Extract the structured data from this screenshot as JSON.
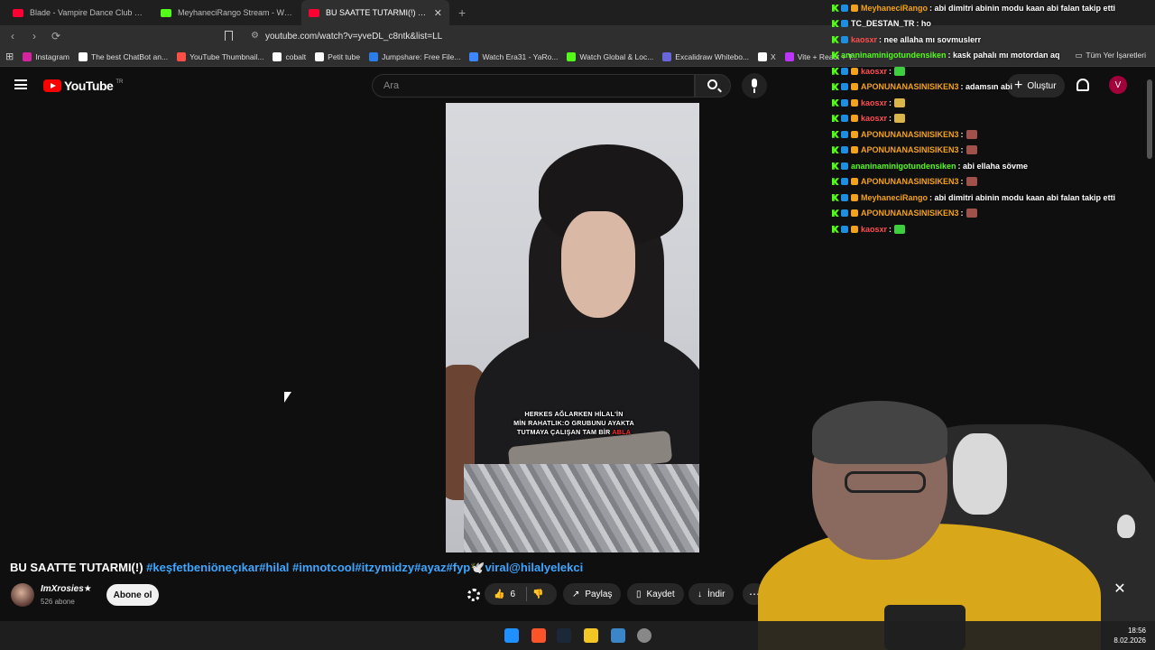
{
  "browser": {
    "tabs": [
      {
        "label": "Blade - Vampire Dance Club Theme",
        "color": "#ff0033",
        "active": false
      },
      {
        "label": "MeyhaneciRango Stream - Watch Live",
        "color": "#53fc18",
        "active": false
      },
      {
        "label": "BU SAATTE TUTARMI(!) #keşfetb",
        "color": "#ff0033",
        "active": true
      }
    ],
    "tab_close": "✕",
    "new_tab": "+",
    "url": "youtube.com/watch?v=yveDL_c8ntk&list=LL",
    "bookmarks": [
      {
        "label": "Instagram",
        "color": "#d6249f"
      },
      {
        "label": "The best ChatBot an...",
        "color": "#ffffff"
      },
      {
        "label": "YouTube Thumbnail...",
        "color": "#ff4e45"
      },
      {
        "label": "cobalt",
        "color": "#ffffff"
      },
      {
        "label": "Petit tube",
        "color": "#ffffff"
      },
      {
        "label": "Jumpshare: Free File...",
        "color": "#2b7de9"
      },
      {
        "label": "Watch Era31 - YaRo...",
        "color": "#3d86ff"
      },
      {
        "label": "Watch Global & Loc...",
        "color": "#53fc18"
      },
      {
        "label": "Excalidraw Whitebo...",
        "color": "#6965db"
      },
      {
        "label": "X",
        "color": "#ffffff"
      },
      {
        "label": "Vite + React + T...",
        "color": "#bd34fe"
      }
    ],
    "bookmarks_right": "Tüm Yer İşaretleri"
  },
  "youtube": {
    "logo_word": "YouTube",
    "country": "TR",
    "search_placeholder": "Ara",
    "create_label": "Oluştur",
    "avatar_letter": "V"
  },
  "video": {
    "caption_lines": [
      "HERKES AĞLARKEN HİLAL'İN",
      "MİN RAHATLIK:O GRUBUNU AYAKTA",
      "TUTMAYA ÇALIŞAN TAM BİR"
    ],
    "caption_highlight": "ABLA",
    "title_main": "BU SAATTE TUTARMI(!) ",
    "title_tags": "#keşfetbeniöneçıkar#hilal #imnotcool#itzymidzy#ayaz#fyp🕊️viral@hilalyelekci",
    "channel_name": "ImXrosies★",
    "subscribers": "526 abone",
    "subscribe_label": "Abone ol",
    "like_count": "6",
    "share_label": "Paylaş",
    "save_label": "Kaydet",
    "download_label": "İndir",
    "more_label": "⋯"
  },
  "chat": [
    {
      "user": "MeyhaneciRango",
      "color": "#f3a21a",
      "text": ": abi dimitri abinin modu kaan abi falan takip etti",
      "badges": 2
    },
    {
      "user": "TC_DESTAN_TR",
      "color": "#ffffff",
      "text": ": ho",
      "badges": 1
    },
    {
      "user": "kaosxr",
      "color": "#ff4d4d",
      "text": ": nee allaha mı sovmuslerr",
      "badges": 1
    },
    {
      "user": "ananinaminigotundensiken",
      "color": "#53fc18",
      "text": ": kask pahalı mı motordan aq",
      "badges": 0
    },
    {
      "user": "kaosxr",
      "color": "#ff4d4d",
      "text": ":",
      "badges": 2,
      "emote": "#3ecf3e"
    },
    {
      "user": "APONUNANASINISIKEN3",
      "color": "#f3a21a",
      "text": ": adamsın abi",
      "badges": 2
    },
    {
      "user": "kaosxr",
      "color": "#ff4d4d",
      "text": ":",
      "badges": 2,
      "emote": "#d9b54a"
    },
    {
      "user": "kaosxr",
      "color": "#ff4d4d",
      "text": ":",
      "badges": 2,
      "emote": "#d9b54a"
    },
    {
      "user": "APONUNANASINISIKEN3",
      "color": "#f3a21a",
      "text": ":",
      "badges": 2,
      "emote": "#a0524a"
    },
    {
      "user": "APONUNANASINISIKEN3",
      "color": "#f3a21a",
      "text": ":",
      "badges": 2,
      "emote": "#a0524a"
    },
    {
      "user": "ananinaminigotundensiken",
      "color": "#53fc18",
      "text": ": abi ellaha sövme",
      "badges": 1
    },
    {
      "user": "APONUNANASINISIKEN3",
      "color": "#f3a21a",
      "text": ":",
      "badges": 2,
      "emote": "#a0524a"
    },
    {
      "user": "MeyhaneciRango",
      "color": "#f3a21a",
      "text": ": abi dimitri abinin modu kaan abi falan takip etti",
      "badges": 2
    },
    {
      "user": "APONUNANASINISIKEN3",
      "color": "#f3a21a",
      "text": ":",
      "badges": 2,
      "emote": "#a0524a"
    },
    {
      "user": "kaosxr",
      "color": "#ff4d4d",
      "text": ":",
      "badges": 2,
      "emote": "#3ecf3e"
    }
  ],
  "overlay_close": "✕",
  "taskbar": {
    "time": "18:56",
    "date": "8.02.2026"
  }
}
